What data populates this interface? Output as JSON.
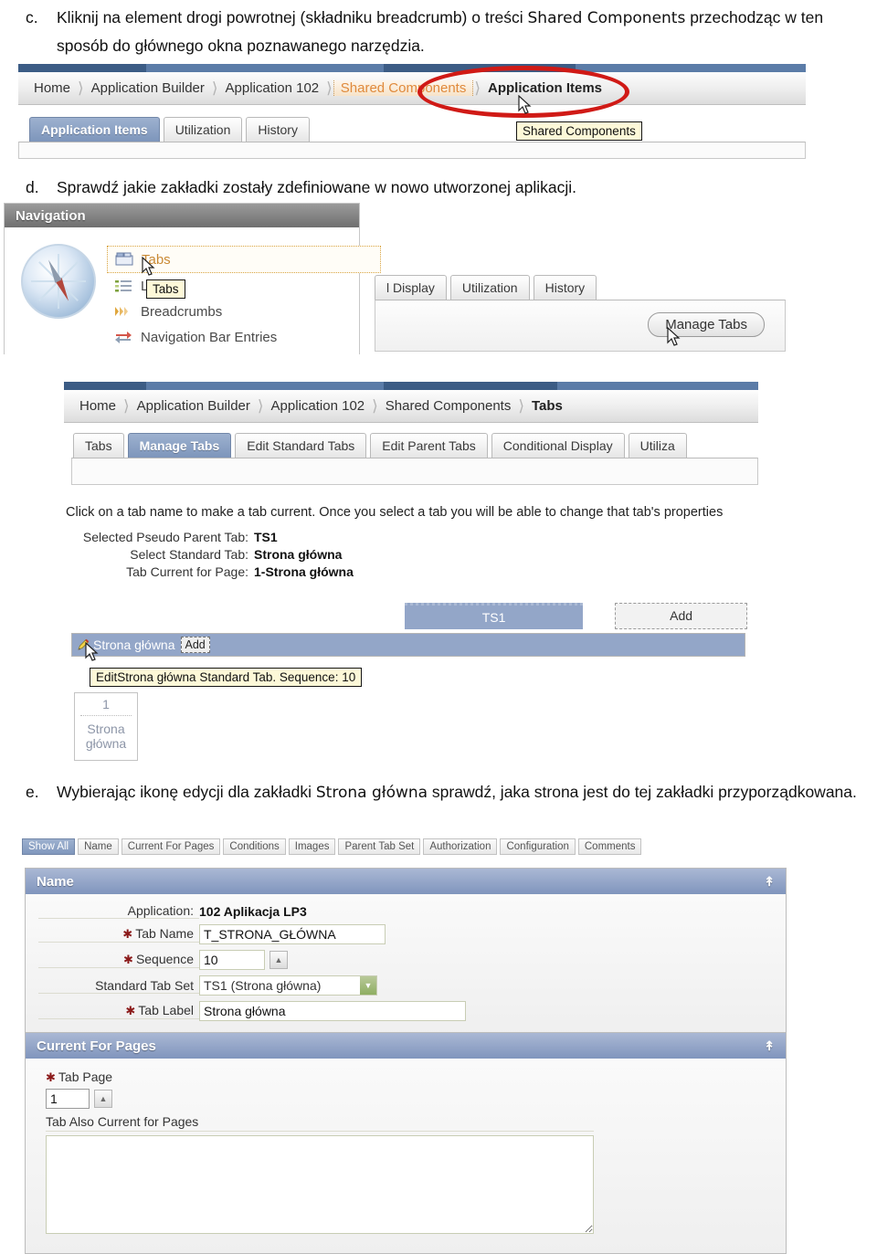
{
  "instructions": {
    "c": {
      "marker": "c.",
      "text_1": "Kliknij na element drogi powrotnej (składniku breadcrumb) o treści ",
      "emph_1": "Shared Components",
      "text_2": " przechodząc w ten sposób do głównego okna poznawanego narzędzia."
    },
    "d": {
      "marker": "d.",
      "text_1": "Sprawdź jakie zakładki zostały zdefiniowane w nowo utworzonej aplikacji."
    },
    "e": {
      "marker": "e.",
      "text_1": "Wybierając ikonę edycji dla zakładki ",
      "emph_1": "Strona główna",
      "text_2": " sprawdź, jaka strona jest do tej zakładki przyporządkowana."
    }
  },
  "shot_c": {
    "breadcrumb": [
      {
        "label": "Home",
        "state": "link"
      },
      {
        "label": "Application Builder",
        "state": "link"
      },
      {
        "label": "Application 102",
        "state": "link"
      },
      {
        "label": "Shared Components",
        "state": "hover"
      },
      {
        "label": "Application Items",
        "state": "current"
      }
    ],
    "tabs": [
      {
        "label": "Application Items",
        "selected": true
      },
      {
        "label": "Utilization",
        "selected": false
      },
      {
        "label": "History",
        "selected": false
      }
    ],
    "tooltip": "Shared Components",
    "annotation_shape": "red-ellipse"
  },
  "shot_d_nav": {
    "region_title": "Navigation",
    "items": [
      {
        "label": "Tabs",
        "icon": "tabs-icon",
        "focused": true
      },
      {
        "label": "Lists",
        "icon": "lists-icon",
        "focused": false
      },
      {
        "label": "Breadcrumbs",
        "icon": "breadcrumbs-icon",
        "focused": false
      },
      {
        "label": "Navigation Bar Entries",
        "icon": "navbar-icon",
        "focused": false
      }
    ],
    "tooltip": "Tabs"
  },
  "shot_d_right": {
    "tabs": [
      {
        "label": "l Display",
        "selected": false
      },
      {
        "label": "Utilization",
        "selected": false
      },
      {
        "label": "History",
        "selected": false
      }
    ],
    "button": "Manage Tabs"
  },
  "shot_tabs": {
    "breadcrumb": [
      {
        "label": "Home",
        "state": "link"
      },
      {
        "label": "Application Builder",
        "state": "link"
      },
      {
        "label": "Application 102",
        "state": "link"
      },
      {
        "label": "Shared Components",
        "state": "link"
      },
      {
        "label": "Tabs",
        "state": "current"
      }
    ],
    "tabs": [
      {
        "label": "Tabs",
        "selected": false
      },
      {
        "label": "Manage Tabs",
        "selected": true
      },
      {
        "label": "Edit Standard Tabs",
        "selected": false
      },
      {
        "label": "Edit Parent Tabs",
        "selected": false
      },
      {
        "label": "Conditional Display",
        "selected": false
      },
      {
        "label": "Utiliza",
        "selected": false
      }
    ],
    "hint": "Click on a tab name to make a tab current. Once you select a tab you will be able to change that tab's properties",
    "fields": [
      {
        "label": "Selected Pseudo Parent Tab:",
        "value": "TS1"
      },
      {
        "label": "Select Standard Tab:",
        "value": "Strona główna"
      },
      {
        "label": "Tab Current for Page:",
        "value": "1-Strona główna"
      }
    ],
    "board": {
      "parent_tab": "TS1",
      "add_parent": "Add",
      "row_label": "Strona główna",
      "row_add": "Add",
      "tooltip": "EditStrona główna Standard Tab. Sequence: 10",
      "page_card": {
        "number": "1",
        "name_line_1": "Strona",
        "name_line_2": "główna"
      }
    }
  },
  "shot_e": {
    "minibuttons": [
      {
        "label": "Show All",
        "selected": true
      },
      {
        "label": "Name",
        "selected": false
      },
      {
        "label": "Current For Pages",
        "selected": false
      },
      {
        "label": "Conditions",
        "selected": false
      },
      {
        "label": "Images",
        "selected": false
      },
      {
        "label": "Parent Tab Set",
        "selected": false
      },
      {
        "label": "Authorization",
        "selected": false
      },
      {
        "label": "Configuration",
        "selected": false
      },
      {
        "label": "Comments",
        "selected": false
      }
    ],
    "panel_name": {
      "title": "Name",
      "application_label": "Application:",
      "application_value": "102 Aplikacja LP3",
      "tab_name_label": "Tab Name",
      "tab_name_value": "T_STRONA_GŁÓWNA",
      "sequence_label": "Sequence",
      "sequence_value": "10",
      "standard_tab_set_label": "Standard Tab Set",
      "standard_tab_set_value": "TS1 (Strona główna)",
      "tab_label_label": "Tab Label",
      "tab_label_value": "Strona główna"
    },
    "panel_pages": {
      "title": "Current For Pages",
      "tab_page_label": "Tab Page",
      "tab_page_value": "1",
      "also_current_label": "Tab Also Current for Pages",
      "also_current_value": ""
    }
  },
  "colors": {
    "accent_blue": "#7d95bb",
    "panel_head": "#8095bd",
    "annotation_red": "#d01a16",
    "hover_orange": "#e08a3c",
    "tooltip_bg": "#fdf8d8",
    "nav_head_gray": "#6f6f6f",
    "board_blue": "#93a6c8"
  }
}
